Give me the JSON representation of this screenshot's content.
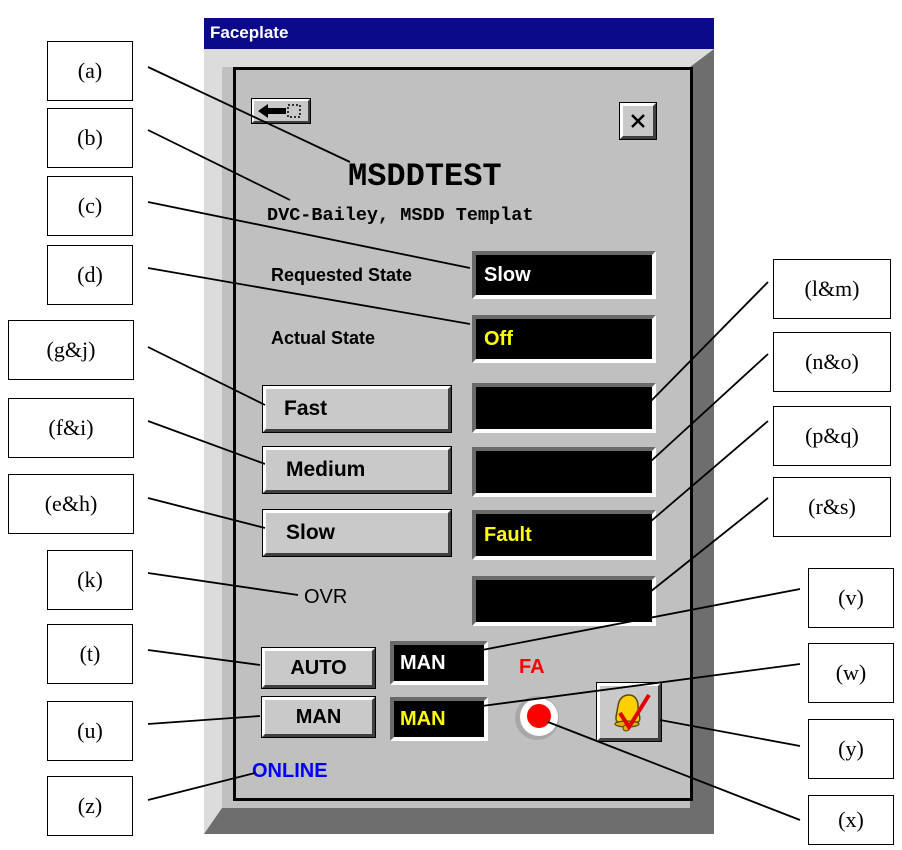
{
  "window": {
    "title": "Faceplate"
  },
  "faceplate": {
    "tag": "MSDDTEST",
    "description": "DVC-Bailey, MSDD Templat",
    "requested_state_label": "Requested State",
    "requested_state_value": "Slow",
    "actual_state_label": "Actual State",
    "actual_state_value": "Off",
    "buttons": {
      "fast": "Fast",
      "medium": "Medium",
      "slow": "Slow",
      "auto": "AUTO",
      "man": "MAN"
    },
    "status_fields": {
      "fast": "",
      "medium": "",
      "slow": "Fault",
      "ovr": ""
    },
    "ovr_label": "OVR",
    "mode_requested": "MAN",
    "mode_actual": "MAN",
    "alarm_label": "FA",
    "connection_status": "ONLINE",
    "icons": {
      "back": "back-arrow-icon",
      "close": "close-icon",
      "alarm_ack": "alarm-bell-check-icon",
      "alarm_light": "alarm-indicator-icon"
    }
  },
  "colors": {
    "title_bar": "#0a0a8a",
    "field_bg": "#000000",
    "white_text": "#ffffff",
    "yellow_text": "#ffff00",
    "alarm_red": "#ff0000",
    "online_blue": "#0000ff"
  },
  "callouts": [
    "(a)",
    "(b)",
    "(c)",
    "(d)",
    "(g&j)",
    "(f&i)",
    "(e&h)",
    "(k)",
    "(t)",
    "(u)",
    "(z)",
    "(l&m)",
    "(n&o)",
    "(p&q)",
    "(r&s)",
    "(v)",
    "(w)",
    "(y)",
    "(x)"
  ]
}
